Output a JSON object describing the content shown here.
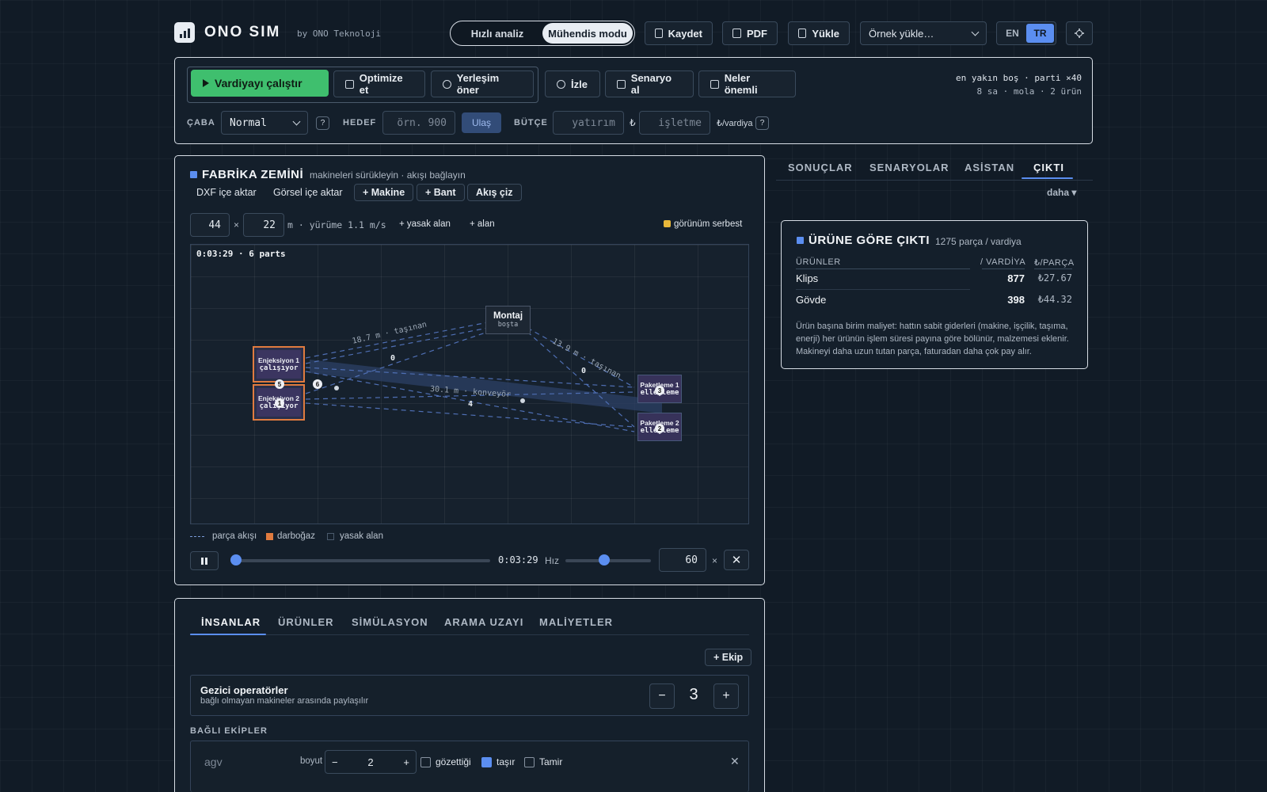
{
  "header": {
    "brand": "ONO SIM",
    "brand_sub": "by ONO Teknoloji",
    "modes": [
      "Hızlı analiz",
      "Mühendis modu"
    ],
    "save": "Kaydet",
    "pdf": "PDF",
    "upload": "Yükle",
    "example_select": "Örnek yükle…",
    "lang_en": "EN",
    "lang_tr": "TR"
  },
  "toolbar": {
    "run": "Vardiyayı çalıştır",
    "optimize": "Optimize et",
    "layout": "Yerleşim öner",
    "watch": "İzle",
    "snapshot": "Senaryo al",
    "matters": "Neler önemli",
    "meta_line1": "en yakın boş · parti ×40",
    "meta_line2": "8 sa · mola · 2 ürün",
    "effort_label": "ÇABA",
    "effort_value": "Normal",
    "help": "?",
    "target_label": "HEDEF",
    "target_placeholder": "örn. 900",
    "reach": "Ulaş",
    "budget_label": "BÜTÇE",
    "invest_placeholder": "yatırım",
    "currency": "₺",
    "opex_placeholder": "işletme",
    "per_shift": "₺/vardiya"
  },
  "floor": {
    "title": "FABRİKA ZEMİNİ",
    "subtitle": "makineleri sürükleyin · akışı bağlayın",
    "dxf": "DXF içe aktar",
    "image": "Görsel içe aktar",
    "add_machine": "+ Makine",
    "add_belt": "+ Bant",
    "draw_flow": "Akış çiz",
    "width": "44",
    "times": "×",
    "height": "22",
    "unit_walk": "m · yürüme 1.1 m/s",
    "forbidden": "+ yasak alan",
    "area": "+ alan",
    "view_free": "görünüm serbest",
    "canvas_status": "0:03:29 · 6 parts",
    "machines": {
      "inj1": {
        "name": "Enjeksiyon 1",
        "state": "çalışıyor"
      },
      "inj2": {
        "name": "Enjeksiyon 2",
        "state": "çalışıyor"
      },
      "montaj": {
        "name": "Montaj",
        "state": "boşta"
      },
      "pack1": {
        "name": "Paketleme 1",
        "state": "elleçleme"
      },
      "pack2": {
        "name": "Paketleme 2",
        "state": "elleçleme"
      }
    },
    "flow_labels": {
      "a": "18.7 m · taşınan",
      "b": "13.9 m · taşınan",
      "c": "30.1 m · konveyör",
      "q1": "0",
      "q2": "0",
      "q3": "4"
    },
    "badges": [
      "5",
      "1",
      "6",
      "3",
      "2"
    ],
    "legend": {
      "flow": "parça akışı",
      "bottleneck": "darboğaz",
      "forbidden": "yasak alan"
    },
    "time": "0:03:29",
    "speed_label": "Hız",
    "speed_value": "60",
    "speed_unit": "×",
    "timeline_progress": 0.0,
    "speed_progress": 0.45
  },
  "right": {
    "tabs": [
      "SONUÇLAR",
      "SENARYOLAR",
      "ASİSTAN",
      "ÇIKTI"
    ],
    "more": "daha ▾",
    "out_title": "ÜRÜNE GÖRE ÇIKTI",
    "out_sub": "1275 parça / vardiya",
    "cols": [
      "ÜRÜNLER",
      "/ VARDİYA",
      "₺/PARÇA"
    ],
    "rows": [
      {
        "name": "Klips",
        "qty": "877",
        "cost": "₺27.67"
      },
      {
        "name": "Gövde",
        "qty": "398",
        "cost": "₺44.32"
      }
    ],
    "note": "Ürün başına birim maliyet: hattın sabit giderleri (makine, işçilik, taşıma, enerji) her ürünün işlem süresi payına göre bölünür, malzemesi eklenir. Makineyi daha uzun tutan parça, faturadan daha çok pay alır."
  },
  "bottom": {
    "tabs": [
      "İNSANLAR",
      "ÜRÜNLER",
      "SİMÜLASYON",
      "ARAMA UZAYI",
      "MALİYETLER"
    ],
    "add_team": "+ Ekip",
    "roaming_title": "Gezici operatörler",
    "roaming_sub": "bağlı olmayan makineler arasında paylaşılır",
    "roaming_count": "3",
    "minus": "−",
    "plus": "+",
    "linked_label": "BAĞLI EKİPLER",
    "team_name": "agv",
    "size_label": "boyut",
    "team_size": "2",
    "chk_watch": "gözettiği",
    "chk_carry": "taşır",
    "chk_repair": "Tamir"
  },
  "colors": {
    "accent": "#5b8ef0",
    "run": "#3fbf6e",
    "bottleneck": "#e07b3f"
  }
}
